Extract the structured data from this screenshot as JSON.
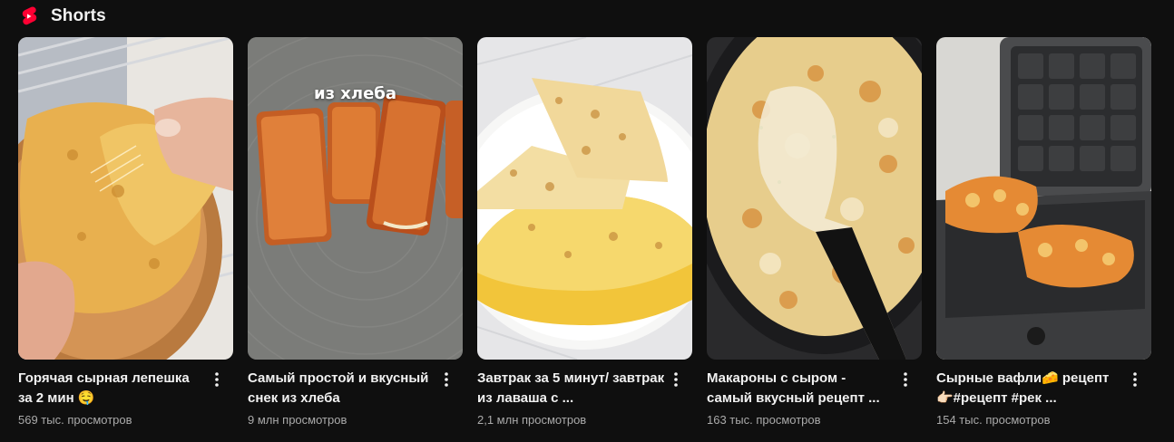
{
  "shelf": {
    "title": "Shorts",
    "logo_icon": "youtube-shorts-icon",
    "accent_color": "#ff0033"
  },
  "cards": [
    {
      "title": "Горячая сырная лепешка за 2 мин 🤤",
      "views": "569 тыс. просмотров",
      "more_icon": "more-vert-icon"
    },
    {
      "title": "Самый простой и вкусный снек из хлеба",
      "views": "9 млн просмотров",
      "overlay": "из хлеба",
      "more_icon": "more-vert-icon"
    },
    {
      "title": "Завтрак за 5 минут/ завтрак из лаваша с ...",
      "views": "2,1 млн просмотров",
      "more_icon": "more-vert-icon"
    },
    {
      "title": "Макароны с сыром - самый вкусный рецепт ...",
      "views": "163 тыс. просмотров",
      "more_icon": "more-vert-icon"
    },
    {
      "title": "Сырные вафли🧀 рецепт 👉🏻#рецепт #рек ...",
      "views": "154 тыс. просмотров",
      "more_icon": "more-vert-icon"
    }
  ]
}
